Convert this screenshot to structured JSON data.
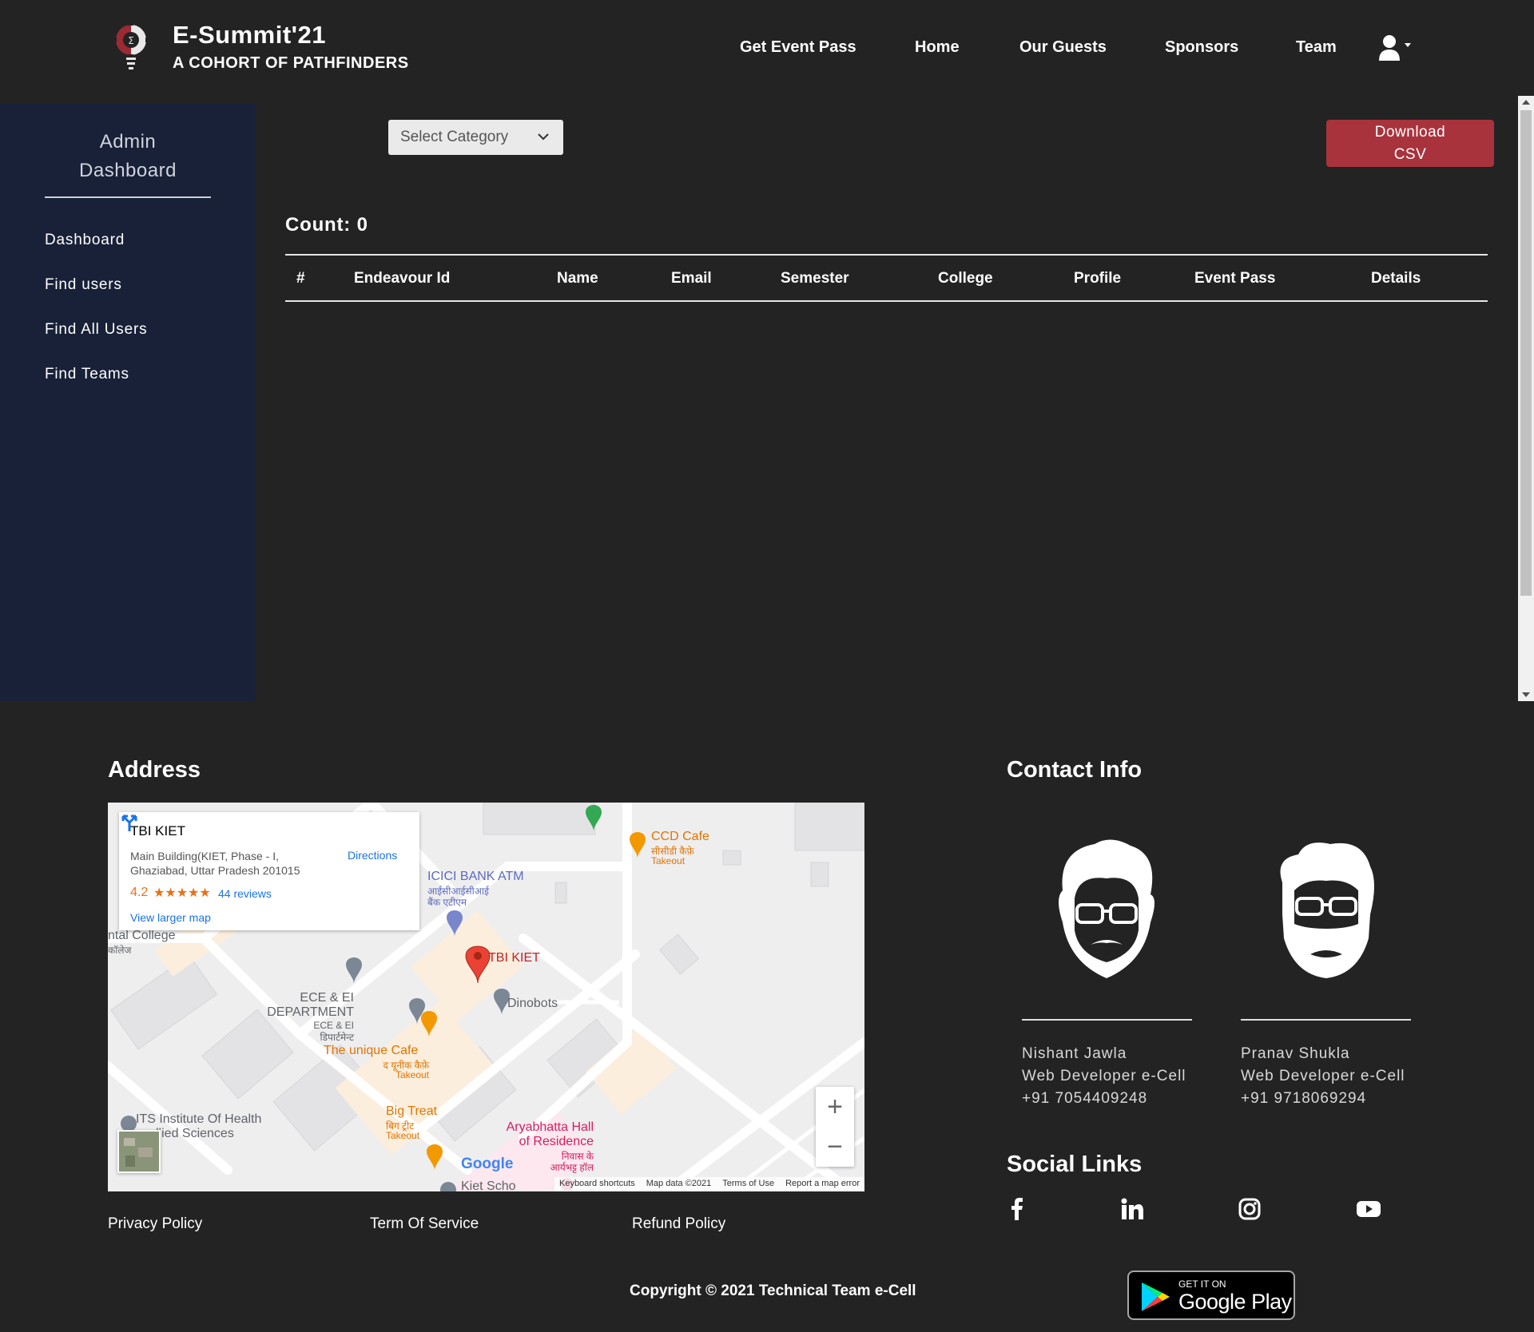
{
  "header": {
    "title": "E-Summit'21",
    "subtitle": "A COHORT OF PATHFINDERS",
    "nav": [
      "Get Event Pass",
      "Home",
      "Our Guests",
      "Sponsors",
      "Team"
    ]
  },
  "sidebar": {
    "title_line1": "Admin",
    "title_line2": "Dashboard",
    "items": [
      "Dashboard",
      "Find users",
      "Find All Users",
      "Find Teams"
    ]
  },
  "main": {
    "select_placeholder": "Select Category",
    "download_line1": "Download",
    "download_line2": "CSV",
    "count_label": "Count: 0",
    "columns": [
      "#",
      "Endeavour Id",
      "Name",
      "Email",
      "Semester",
      "College",
      "Profile",
      "Event Pass",
      "Details"
    ]
  },
  "footer": {
    "address_title": "Address",
    "contact_title": "Contact Info",
    "social_title": "Social Links",
    "map": {
      "place": "TBI KIET",
      "address_line1": "Main Building(KIET, Phase - I,",
      "address_line2": "Ghaziabad, Uttar Pradesh 201015",
      "rating": "4.2",
      "stars": "★★★★★",
      "reviews": "44 reviews",
      "larger_map": "View larger map",
      "directions": "Directions",
      "labels": {
        "ccd": "CCD Cafe",
        "ccd_hi": "सीसीडी कैफ़े",
        "takeout": "Takeout",
        "icici": "ICICI BANK ATM",
        "icici_hi1": "आईसीआईसीआई",
        "icici_hi2": "बैंक एटीएम",
        "college": "ntal College",
        "college_hi": "कॉलेज",
        "pin": "TBI KIET",
        "dinobots": "Dinobots",
        "ece1": "ECE & EI",
        "ece2": "DEPARTMENT",
        "ece_hi1": "ECE & EI",
        "ece_hi2": "डिपार्टमेन्ट",
        "cafe": "The unique Cafe",
        "cafe_hi": "द यूनीक कैफ़े",
        "its1": "ITS Institute Of Health",
        "its2": "llied Sciences",
        "bigtreat": "Big Treat",
        "bigtreat_hi": "बिग ट्रीट",
        "arya1": "Aryabhatta Hall",
        "arya2": "of Residence",
        "arya_hi1": "निवास के",
        "arya_hi2": "आर्यभट्ट हॉल",
        "kiet_sch": "Kiet Scho"
      },
      "google": "Google",
      "attribution": [
        "Keyboard shortcuts",
        "Map data ©2021",
        "Terms of Use",
        "Report a map error"
      ]
    },
    "policies": [
      "Privacy Policy",
      "Term Of Service",
      "Refund Policy"
    ],
    "copyright": "Copyright © 2021 Technical Team e-Cell",
    "contacts": [
      {
        "name": "Nishant Jawla",
        "role": "Web Developer e-Cell",
        "phone": "+91 7054409248"
      },
      {
        "name": "Pranav Shukla",
        "role": "Web Developer e-Cell",
        "phone": "+91 9718069294"
      }
    ],
    "gplay_small": "GET IT ON",
    "gplay_big": "Google Play"
  },
  "colors": {
    "background": "#232323",
    "sidebar": "#192138",
    "download_button": "#a8333d",
    "link": "#1a73e8"
  },
  "icons": [
    "logo-gear-icon",
    "user-icon",
    "chevron-down-icon",
    "directions-icon",
    "facebook-icon",
    "linkedin-icon",
    "instagram-icon",
    "youtube-icon",
    "google-play-icon"
  ]
}
